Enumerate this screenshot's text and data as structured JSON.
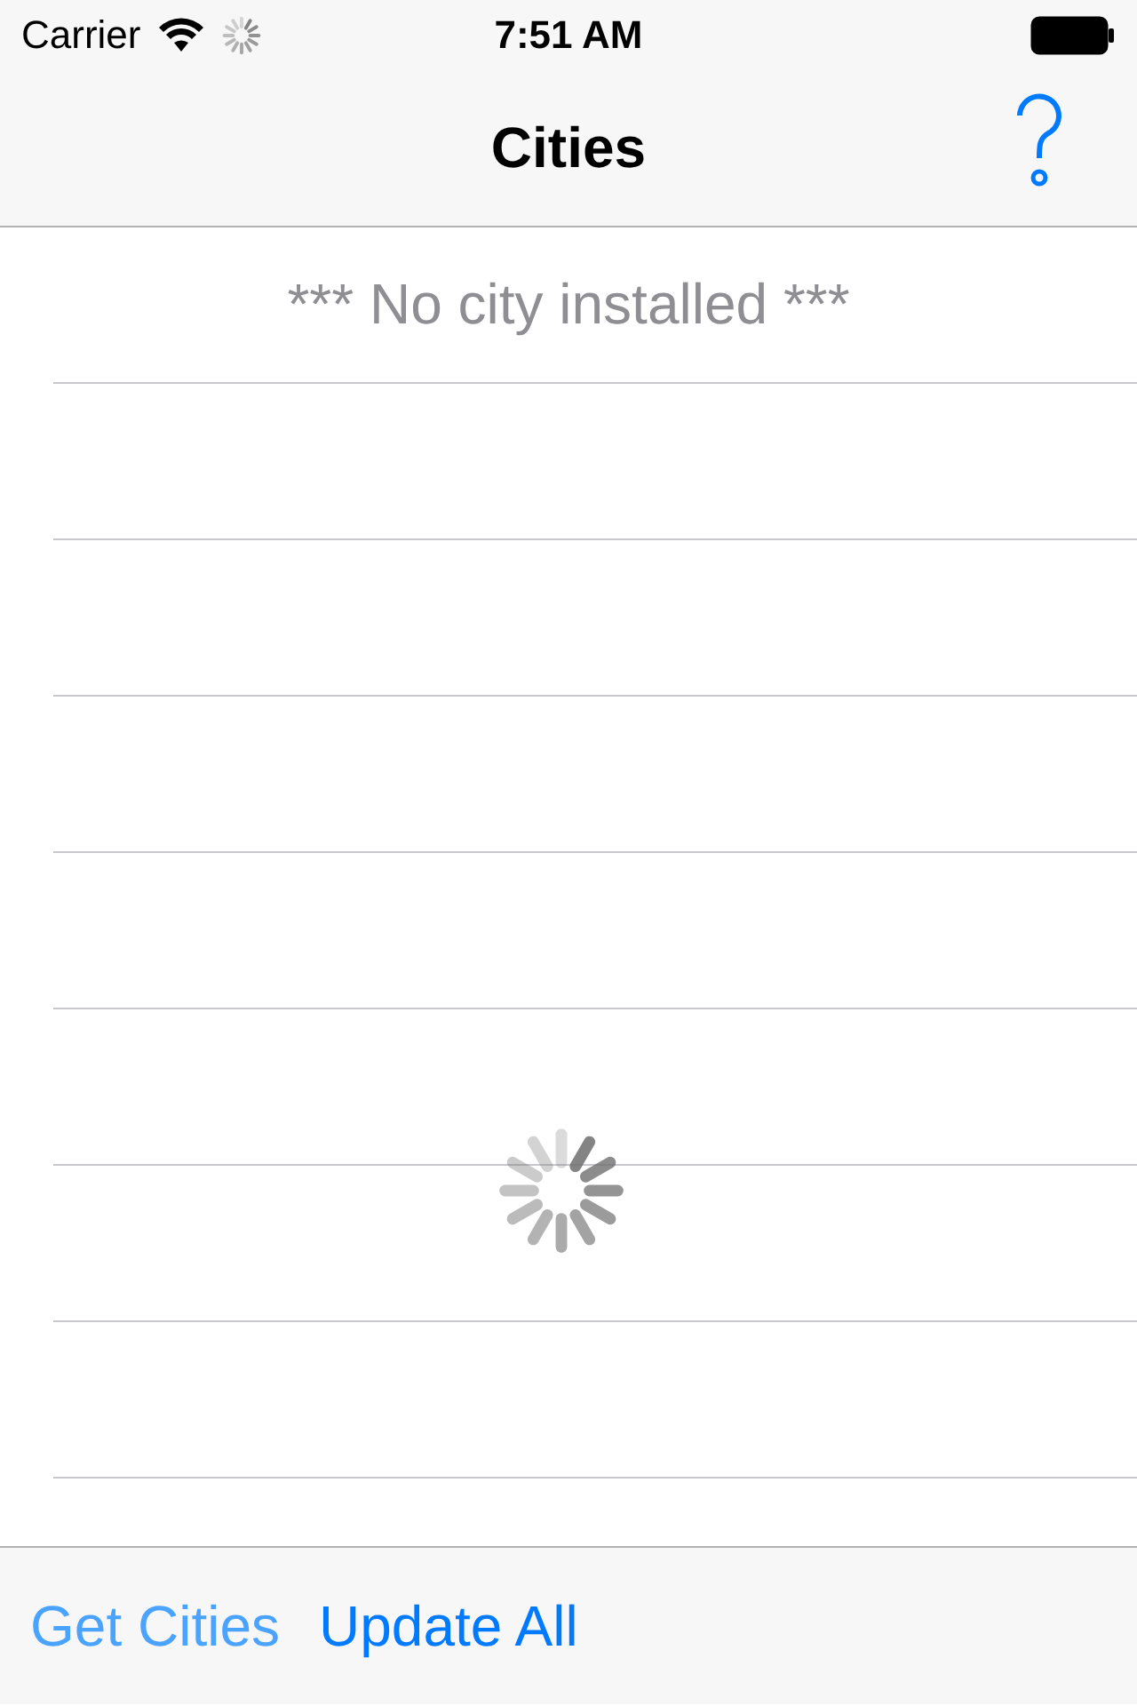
{
  "status_bar": {
    "carrier": "Carrier",
    "time": "7:51 AM"
  },
  "nav_bar": {
    "title": "Cities"
  },
  "table": {
    "rows": [
      {
        "text": "*** No city installed ***"
      }
    ]
  },
  "toolbar": {
    "buttons": [
      {
        "label": "Get Cities",
        "disabled": true
      },
      {
        "label": "Update All",
        "disabled": false
      }
    ]
  }
}
